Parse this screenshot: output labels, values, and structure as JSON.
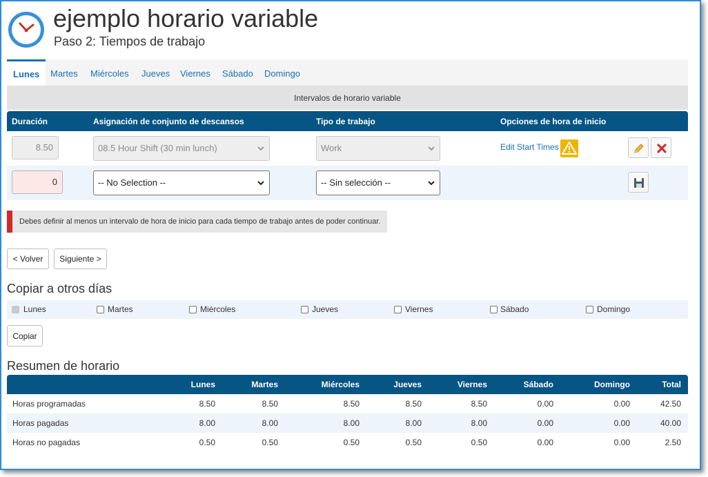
{
  "header": {
    "title": "ejemplo horario variable",
    "subtitle": "Paso 2: Tiempos de trabajo"
  },
  "tabs": [
    {
      "label": "Lunes",
      "active": true
    },
    {
      "label": "Martes"
    },
    {
      "label": "Miércoles"
    },
    {
      "label": "Jueves"
    },
    {
      "label": "Viernes"
    },
    {
      "label": "Sábado"
    },
    {
      "label": "Domingo"
    }
  ],
  "intervals": {
    "heading": "Intervalos de horario variable",
    "columns": [
      "Duración",
      "Asignación de conjunto de descansos",
      "Tipo de trabajo",
      "Opciones de hora de inicio"
    ],
    "rows": [
      {
        "duration": "8.50",
        "break_set": "08.5 Hour Shift (30 min lunch)",
        "work_type": "Work",
        "start_options_link": "Edit Start Times"
      },
      {
        "duration": "0",
        "break_set": "-- No Selection --",
        "work_type": "-- Sin selección --"
      }
    ]
  },
  "alert": {
    "message": "Debes definir al menos un intervalo de hora de inicio para cada tiempo de trabajo antes de poder continuar.",
    "color": "#cc2b2b"
  },
  "nav": {
    "back_label": "< Volver",
    "next_label": "Siguiente >"
  },
  "copy": {
    "heading": "Copiar a otros días",
    "days": [
      {
        "label": "Lunes",
        "checked": true,
        "disabled": true
      },
      {
        "label": "Martes",
        "checked": false
      },
      {
        "label": "Miércoles",
        "checked": false
      },
      {
        "label": "Jueves",
        "checked": false
      },
      {
        "label": "Viernes",
        "checked": false
      },
      {
        "label": "Sábado",
        "checked": false
      },
      {
        "label": "Domingo",
        "checked": false
      }
    ],
    "button_label": "Copiar"
  },
  "summary": {
    "heading": "Resumen de horario",
    "columns": [
      "",
      "Lunes",
      "Martes",
      "Miércoles",
      "Jueves",
      "Viernes",
      "Sábado",
      "Domingo",
      "Total"
    ],
    "rows": [
      {
        "label": "Horas programadas",
        "values": [
          "8.50",
          "8.50",
          "8.50",
          "8.50",
          "8.50",
          "0.00",
          "0.00",
          "42.50"
        ]
      },
      {
        "label": "Horas pagadas",
        "values": [
          "8.00",
          "8.00",
          "8.00",
          "8.00",
          "8.00",
          "0.00",
          "0.00",
          "40.00"
        ]
      },
      {
        "label": "Horas no pagadas",
        "values": [
          "0.50",
          "0.50",
          "0.50",
          "0.50",
          "0.50",
          "0.00",
          "0.00",
          "2.50"
        ]
      }
    ]
  },
  "colors": {
    "header_bar": "#075584",
    "link": "#1a6fb5",
    "alt_row": "#eef4fb",
    "warning": "#f0b400"
  }
}
